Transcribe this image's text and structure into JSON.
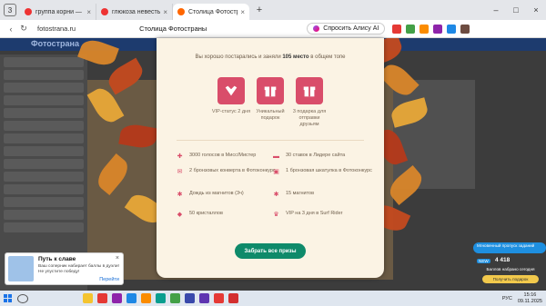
{
  "browser": {
    "tab_count": "3",
    "tabs": [
      {
        "title": "группа корни — Яндекс…",
        "color": "#e33"
      },
      {
        "title": "глюкоза невесты — Янде…",
        "color": "#e33"
      },
      {
        "title": "Столица Фотостраны",
        "color": "#f60",
        "active": true
      }
    ],
    "url": "fotostrana.ru",
    "page_title": "Столица Фотостраны",
    "alice_label": "Спросить Алису AI"
  },
  "site": {
    "logo": "Фотострана"
  },
  "modal": {
    "headline_prefix": "Вы хорошо постарались и заняли",
    "headline_place": "105 место",
    "headline_suffix": "в общем топе",
    "rewards": [
      {
        "icon": "vip-heart-icon",
        "label": "VIP-статус 2 дня"
      },
      {
        "icon": "gift-box-icon",
        "label": "Уникальный подарок"
      },
      {
        "icon": "gift-box-icon",
        "label": "3 подарка для отправки друзьям"
      }
    ],
    "prizes": [
      {
        "icon": "plus-icon",
        "text": "3000 голосов в Мисс/Мистер"
      },
      {
        "icon": "ticket-icon",
        "text": "30 ставок в Лидере сайта"
      },
      {
        "icon": "envelope-icon",
        "text": "2 бронзовых конверта в Фотоконкурс"
      },
      {
        "icon": "casket-icon",
        "text": "1 бронзовая шкатулка в Фотоконкурс"
      },
      {
        "icon": "magnet-icon",
        "text": "Дождь из магнитов (3ч)"
      },
      {
        "icon": "magnet-icon",
        "text": "15 магнитов"
      },
      {
        "icon": "crystal-icon",
        "text": "50 кристаллов"
      },
      {
        "icon": "crown-icon",
        "text": "VIP на 3 дня в Surf Rider"
      }
    ],
    "claim_label": "Забрать все призы",
    "accent": "#d94d6a",
    "button_color": "#0e8a6a"
  },
  "notification": {
    "title": "Путь к славе",
    "text": "Ваш соперник набирает баллы в дуэли! Не упустите победу!",
    "action": "Перейти",
    "close": "×"
  },
  "widget": {
    "line1": "Мгновенный пропуск заданий",
    "badge": "NEW",
    "coins": "4 418",
    "line2": "Баллов набрано сегодня",
    "button": "Получить подарок"
  },
  "taskbar": {
    "lang": "РУС",
    "time": "15:16",
    "date": "09.11.2025"
  }
}
